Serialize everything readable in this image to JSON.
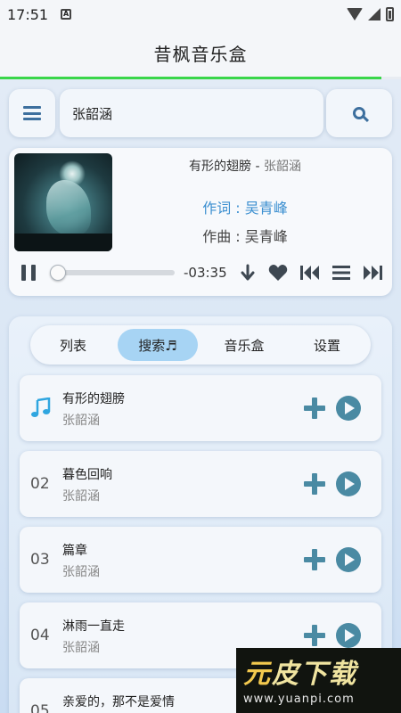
{
  "status_bar": {
    "time": "17:51"
  },
  "app": {
    "title": "昔枫音乐盒"
  },
  "search": {
    "query": "张韶涵"
  },
  "player": {
    "song_title": "有形的翅膀",
    "separator": " - ",
    "artist": "张韶涵",
    "lyricist": "作词 : 吴青峰",
    "composer": "作曲 : 吴青峰",
    "time_remaining": "-03:35",
    "progress": 0.0
  },
  "tabs": [
    {
      "label": "列表",
      "active": false
    },
    {
      "label": "搜索♬",
      "active": true
    },
    {
      "label": "音乐盒",
      "active": false
    },
    {
      "label": "设置",
      "active": false
    }
  ],
  "songs": [
    {
      "index": "",
      "playing": true,
      "title": "有形的翅膀",
      "artist": "张韶涵"
    },
    {
      "index": "02",
      "playing": false,
      "title": "暮色回响",
      "artist": "张韶涵"
    },
    {
      "index": "03",
      "playing": false,
      "title": "篇章",
      "artist": "张韶涵"
    },
    {
      "index": "04",
      "playing": false,
      "title": "淋雨一直走",
      "artist": "张韶涵"
    },
    {
      "index": "05",
      "playing": false,
      "title": "亲爱的，那不是爱情",
      "artist": ""
    }
  ],
  "watermark": {
    "brand_a": "元",
    "brand_b": "皮下载",
    "url": "www.yuanpi.com"
  },
  "colors": {
    "accent": "#3b8fd0",
    "icon": "#4a8aa3",
    "active_tab": "#a7d4f4",
    "progress_green": "#3ad64a"
  }
}
